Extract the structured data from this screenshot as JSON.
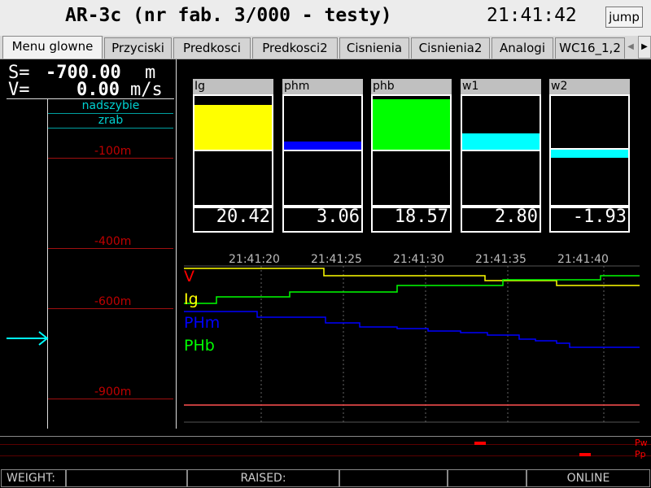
{
  "title": {
    "app": "AR-3c (nr fab. 3/000 - testy)",
    "clock": "21:41:42",
    "jump_label": "jump"
  },
  "tabs": [
    {
      "label": "Menu glowne",
      "active": true
    },
    {
      "label": "Przyciski"
    },
    {
      "label": "Predkosci"
    },
    {
      "label": "Predkosci2"
    },
    {
      "label": "Cisnienia"
    },
    {
      "label": "Cisnienia2"
    },
    {
      "label": "Analogi"
    },
    {
      "label": "WC16_1,2"
    }
  ],
  "readout": {
    "s_label": "S=",
    "s_value": "-700.00",
    "s_unit": "m",
    "v_label": "V=",
    "v_value": "0.00",
    "v_unit": "m/s"
  },
  "shaft": {
    "zones": [
      "nadszybie",
      "zrab"
    ],
    "levels": [
      {
        "label": "-100m"
      },
      {
        "label": "-400m"
      },
      {
        "label": "-600m"
      },
      {
        "label": "-900m"
      }
    ],
    "cage_position_m": -700,
    "arrow_color": "#00ffff"
  },
  "bars": [
    {
      "name": "Ig",
      "value": "20.42",
      "color": "#ffff00",
      "level_fraction": 0.55
    },
    {
      "name": "phm",
      "value": "3.06",
      "color": "#0000ff",
      "level_fraction": 0.1
    },
    {
      "name": "phb",
      "value": "18.57",
      "color": "#00ff00",
      "level_fraction": 0.62
    },
    {
      "name": "w1",
      "value": "2.80",
      "color": "#00ffff",
      "level_fraction": 0.2
    },
    {
      "name": "w2",
      "value": "-1.93",
      "color": "#00ffff",
      "level_fraction": -0.1
    }
  ],
  "trend": {
    "time_labels": [
      "21:41:20",
      "21:41:25",
      "21:41:30",
      "21:41:35",
      "21:41:40"
    ],
    "legend": [
      {
        "name": "V",
        "color": "#ff0000"
      },
      {
        "name": "Ig",
        "color": "#ffff00"
      },
      {
        "name": "PHm",
        "color": "#0000ff"
      },
      {
        "name": "PHb",
        "color": "#00ff00"
      }
    ]
  },
  "bottom_panel": {
    "labels": [
      "Pw",
      "Pp"
    ],
    "color": "#ff0000"
  },
  "status_bar": {
    "weight_label": "WEIGHT:",
    "raised_label": "RAISED:",
    "state": "ONLINE"
  }
}
